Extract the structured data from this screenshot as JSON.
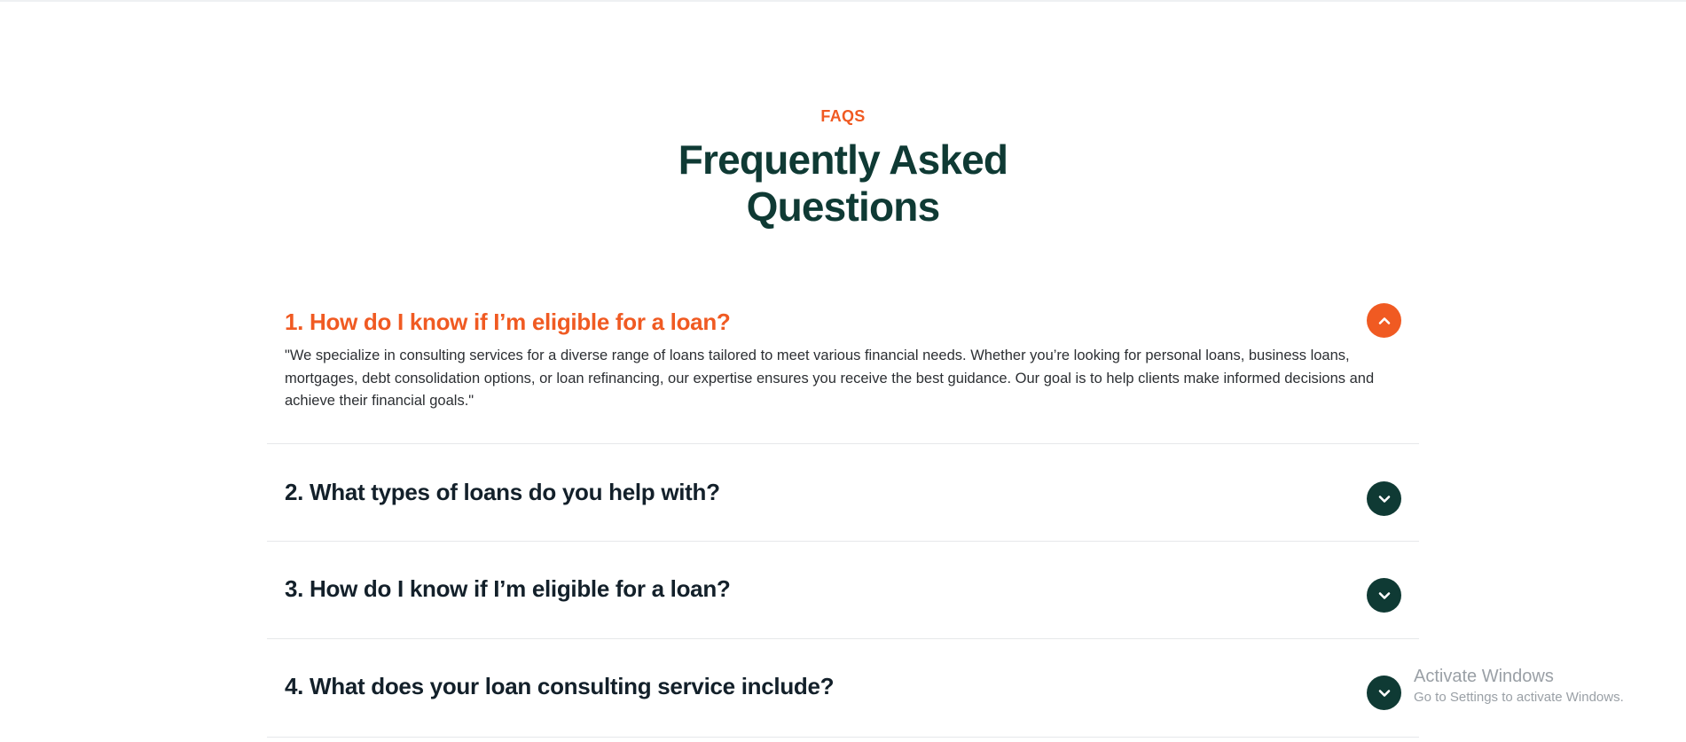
{
  "header": {
    "eyebrow": "FAQS",
    "title_line1": "Frequently Asked",
    "title_line2": "Questions"
  },
  "faqs": [
    {
      "question": "1. How do I know if I’m eligible for a loan?",
      "answer": "\"We specialize in consulting services for a diverse range of loans tailored to meet various financial needs. Whether you’re looking for personal loans, business loans, mortgages, debt consolidation options, or loan refinancing, our expertise ensures you receive the best guidance. Our goal is to help clients make informed decisions and achieve their financial goals.\"",
      "expanded": true,
      "toggle_icon": "chevron-up-icon"
    },
    {
      "question": "2. What types of loans do you help with?",
      "expanded": false,
      "toggle_icon": "chevron-down-icon"
    },
    {
      "question": "3. How do I know if I’m eligible for a loan?",
      "expanded": false,
      "toggle_icon": "chevron-down-icon"
    },
    {
      "question": "4. What does your loan consulting service include?",
      "expanded": false,
      "toggle_icon": "chevron-down-icon"
    }
  ],
  "watermark": {
    "title": "Activate Windows",
    "subtitle": "Go to Settings to activate Windows."
  },
  "colors": {
    "accent": "#f05a22",
    "dark_green": "#0f3a34",
    "text": "#13202a",
    "divider": "#e6e8ea"
  }
}
